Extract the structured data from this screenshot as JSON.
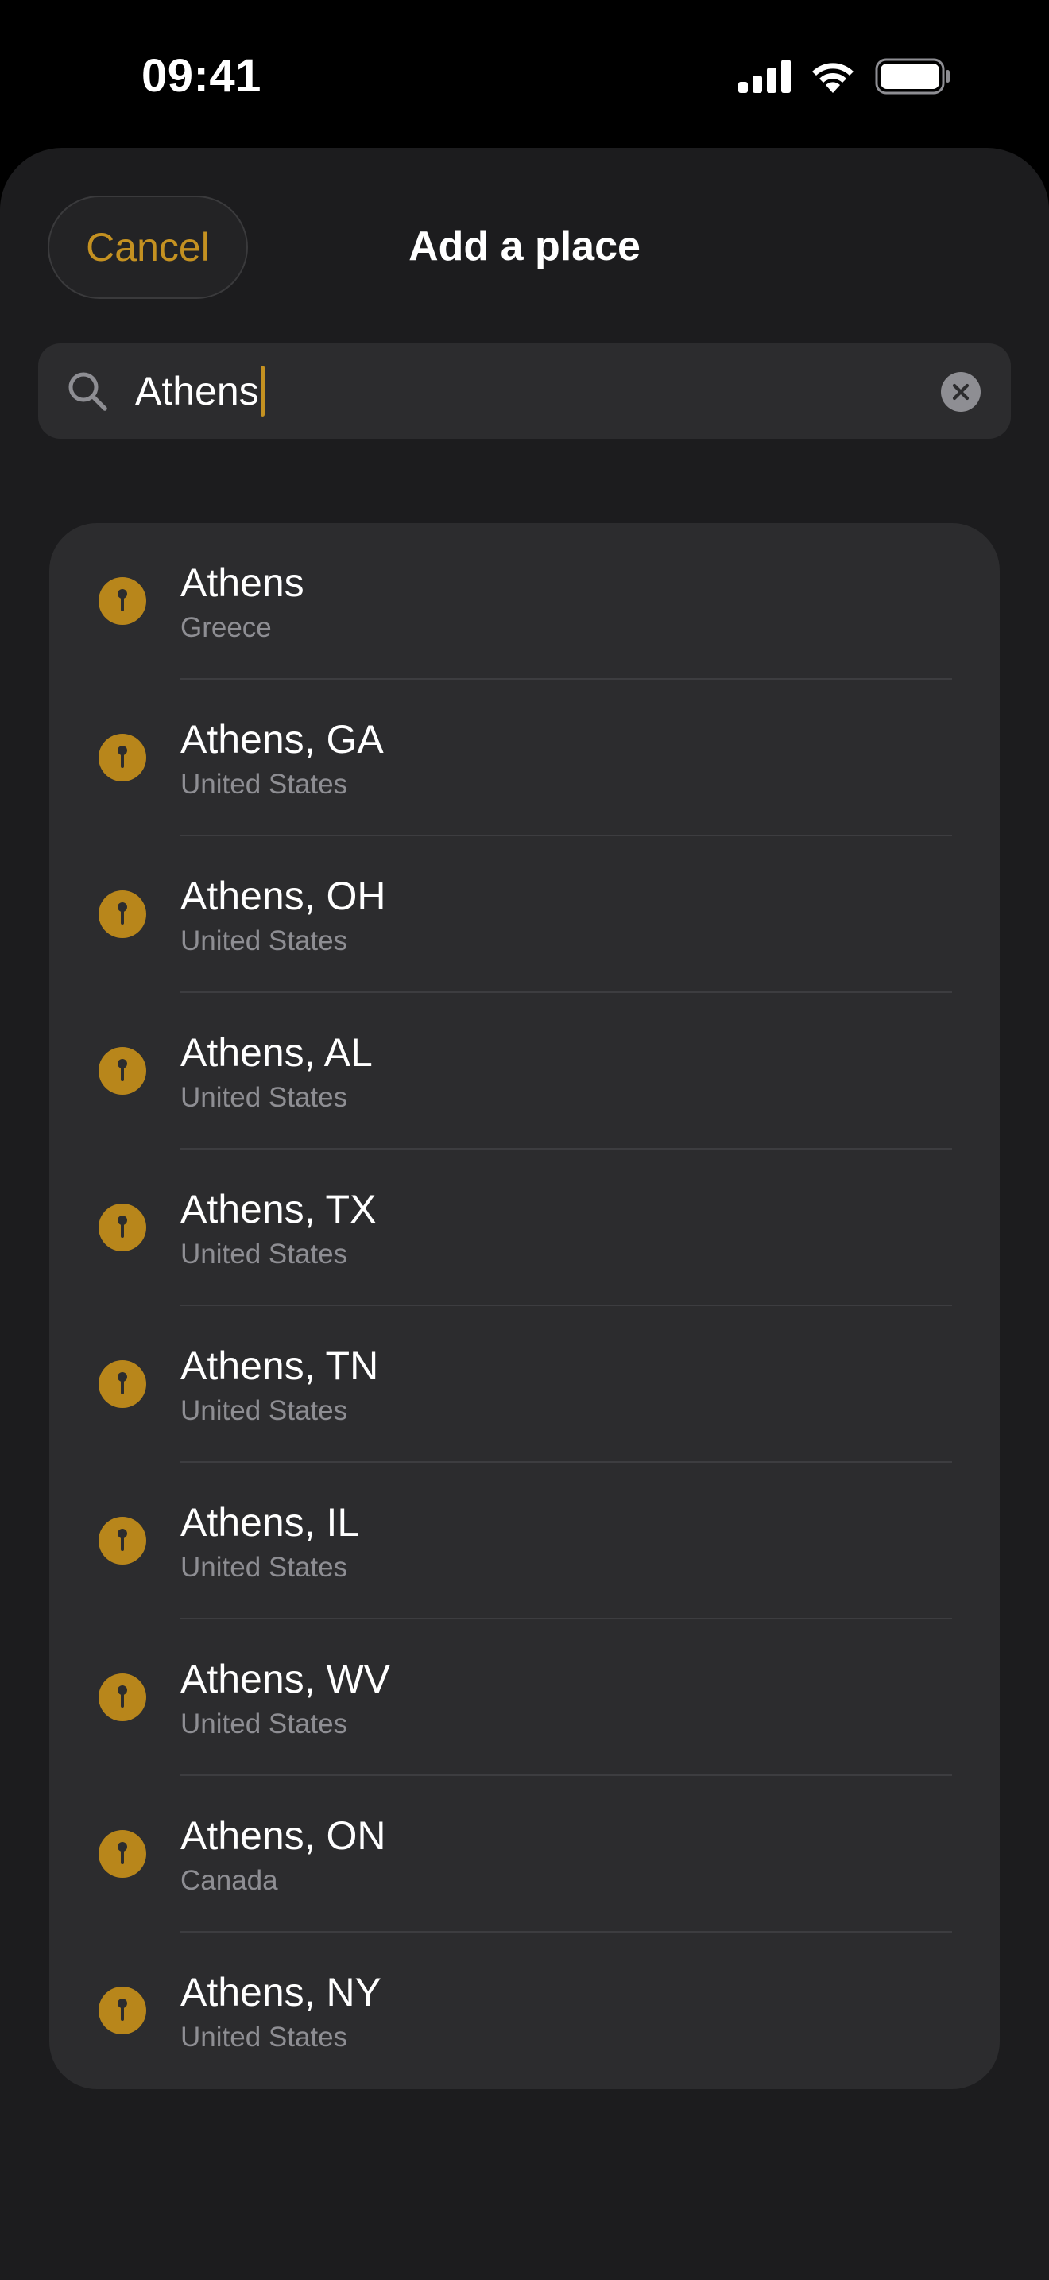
{
  "status_bar": {
    "time": "09:41"
  },
  "header": {
    "cancel_label": "Cancel",
    "title": "Add a place"
  },
  "search": {
    "value": "Athens",
    "icon": "search-icon",
    "clear_icon": "clear-icon"
  },
  "colors": {
    "accent": "#c49121",
    "pin": "#b8861b",
    "sheet_bg": "#1c1c1e",
    "card_bg": "#2c2c2e",
    "secondary_text": "#8e8e93"
  },
  "results": [
    {
      "name": "Athens",
      "country": "Greece",
      "icon": "map-pin-icon"
    },
    {
      "name": "Athens, GA",
      "country": "United States",
      "icon": "map-pin-icon"
    },
    {
      "name": "Athens, OH",
      "country": "United States",
      "icon": "map-pin-icon"
    },
    {
      "name": "Athens, AL",
      "country": "United States",
      "icon": "map-pin-icon"
    },
    {
      "name": "Athens, TX",
      "country": "United States",
      "icon": "map-pin-icon"
    },
    {
      "name": "Athens, TN",
      "country": "United States",
      "icon": "map-pin-icon"
    },
    {
      "name": "Athens, IL",
      "country": "United States",
      "icon": "map-pin-icon"
    },
    {
      "name": "Athens, WV",
      "country": "United States",
      "icon": "map-pin-icon"
    },
    {
      "name": "Athens, ON",
      "country": "Canada",
      "icon": "map-pin-icon"
    },
    {
      "name": "Athens, NY",
      "country": "United States",
      "icon": "map-pin-icon"
    }
  ]
}
